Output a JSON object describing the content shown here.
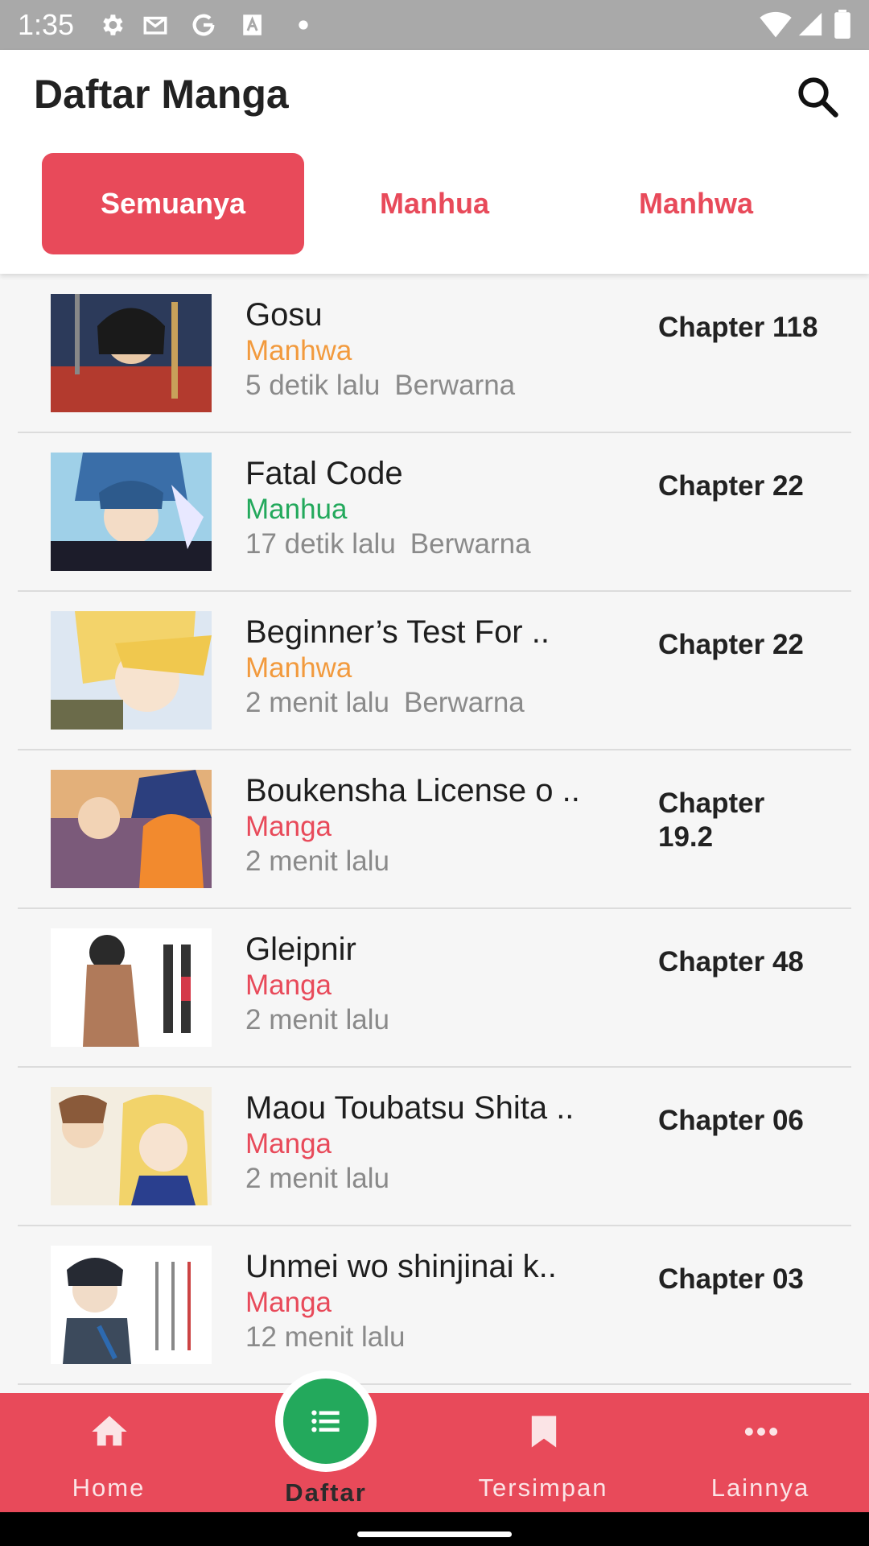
{
  "status_bar": {
    "time": "1:35"
  },
  "header": {
    "title": "Daftar Manga",
    "search_icon": "search-icon"
  },
  "tabs": [
    {
      "label": "Semuanya",
      "active": true
    },
    {
      "label": "Manhua",
      "active": false
    },
    {
      "label": "Manhwa",
      "active": false
    }
  ],
  "colors": {
    "accent": "#e84a5a",
    "manhwa": "#f29a3d",
    "manhua": "#23a95c",
    "manga": "#e84a5a",
    "fab": "#23a95c"
  },
  "items": [
    {
      "title": "Gosu",
      "type": "Manhwa",
      "time": "5 detik lalu",
      "color_tag": "Berwarna",
      "chapter": "Chapter 118"
    },
    {
      "title": "Fatal Code",
      "type": "Manhua",
      "time": "17 detik lalu",
      "color_tag": "Berwarna",
      "chapter": "Chapter 22"
    },
    {
      "title": "Beginner’s Test For ..",
      "type": "Manhwa",
      "time": "2 menit lalu",
      "color_tag": "Berwarna",
      "chapter": "Chapter 22"
    },
    {
      "title": "Boukensha License o ..",
      "type": "Manga",
      "time": "2 menit lalu",
      "color_tag": "",
      "chapter": "Chapter 19.2"
    },
    {
      "title": "Gleipnir",
      "type": "Manga",
      "time": "2 menit lalu",
      "color_tag": "",
      "chapter": "Chapter 48"
    },
    {
      "title": "Maou Toubatsu Shita ..",
      "type": "Manga",
      "time": "2 menit lalu",
      "color_tag": "",
      "chapter": "Chapter 06"
    },
    {
      "title": "Unmei wo shinjinai k..",
      "type": "Manga",
      "time": "12 menit lalu",
      "color_tag": "",
      "chapter": "Chapter 03"
    }
  ],
  "bottom_nav": [
    {
      "label": "Home",
      "icon": "home-icon"
    },
    {
      "label": "Daftar",
      "icon": "list-icon",
      "active": true
    },
    {
      "label": "Tersimpan",
      "icon": "bookmark-icon"
    },
    {
      "label": "Lainnya",
      "icon": "more-icon"
    }
  ]
}
